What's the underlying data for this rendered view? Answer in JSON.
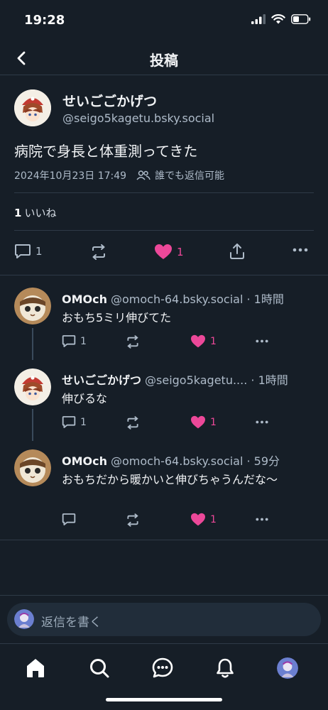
{
  "status_bar": {
    "time": "19:28"
  },
  "header": {
    "title": "投稿"
  },
  "post": {
    "author_name": "せいごごかげつ",
    "author_handle": "@seigo5kagetu.bsky.social",
    "text": "病院で身長と体重測ってきた",
    "timestamp": "2024年10月23日 17:49",
    "reply_setting": "誰でも返信可能",
    "like_count": "1",
    "like_label": "いいね",
    "actions": {
      "reply_count": "1",
      "like_count": "1"
    }
  },
  "replies": [
    {
      "name": "OMOch",
      "handle": "@omoch-64.bsky.social",
      "time": "· 1時間",
      "text": "おもち5ミリ伸びてた",
      "reply_count": "1",
      "like_count": "1"
    },
    {
      "name": "せいごごかげつ",
      "handle": "@seigo5kagetu....",
      "time": "· 1時間",
      "text": "伸びるな",
      "reply_count": "1",
      "like_count": "1"
    },
    {
      "name": "OMOch",
      "handle": "@omoch-64.bsky.social",
      "time": "· 59分",
      "text": "おもちだから暖かいと伸びちゃうんだな〜",
      "reply_count": "",
      "like_count": "1"
    }
  ],
  "composer": {
    "placeholder": "返信を書く"
  },
  "colors": {
    "background": "#161e27",
    "like": "#ec4899",
    "muted": "#aebbc9"
  },
  "icons": [
    "back-icon",
    "reply-icon",
    "repost-icon",
    "heart-icon",
    "share-icon",
    "more-icon",
    "home-icon",
    "search-icon",
    "chat-icon",
    "bell-icon"
  ]
}
